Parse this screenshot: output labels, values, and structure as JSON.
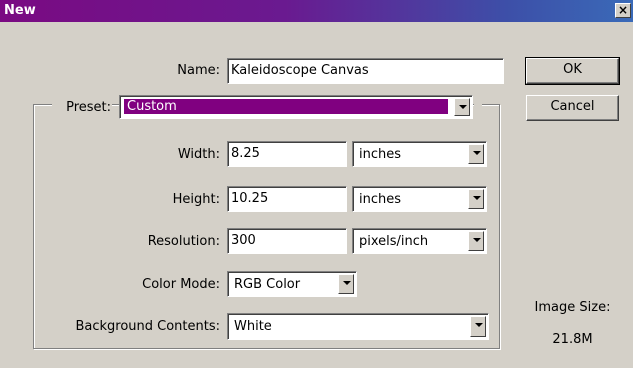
{
  "window": {
    "title": "New",
    "close_glyph": "×"
  },
  "form": {
    "name_label": "Name:",
    "name_value": "Kaleidoscope Canvas",
    "preset_label": "Preset:",
    "preset_value": "Custom",
    "width_label": "Width:",
    "width_value": "8.25",
    "width_unit": "inches",
    "height_label": "Height:",
    "height_value": "10.25",
    "height_unit": "inches",
    "resolution_label": "Resolution:",
    "resolution_value": "300",
    "resolution_unit": "pixels/inch",
    "color_mode_label": "Color Mode:",
    "color_mode_value": "RGB Color",
    "background_label": "Background Contents:",
    "background_value": "White"
  },
  "buttons": {
    "ok": "OK",
    "cancel": "Cancel"
  },
  "image_size": {
    "label": "Image Size:",
    "value": "21.8M"
  },
  "colors": {
    "accent": "#800080",
    "dialog_bg": "#d4d0c8"
  }
}
